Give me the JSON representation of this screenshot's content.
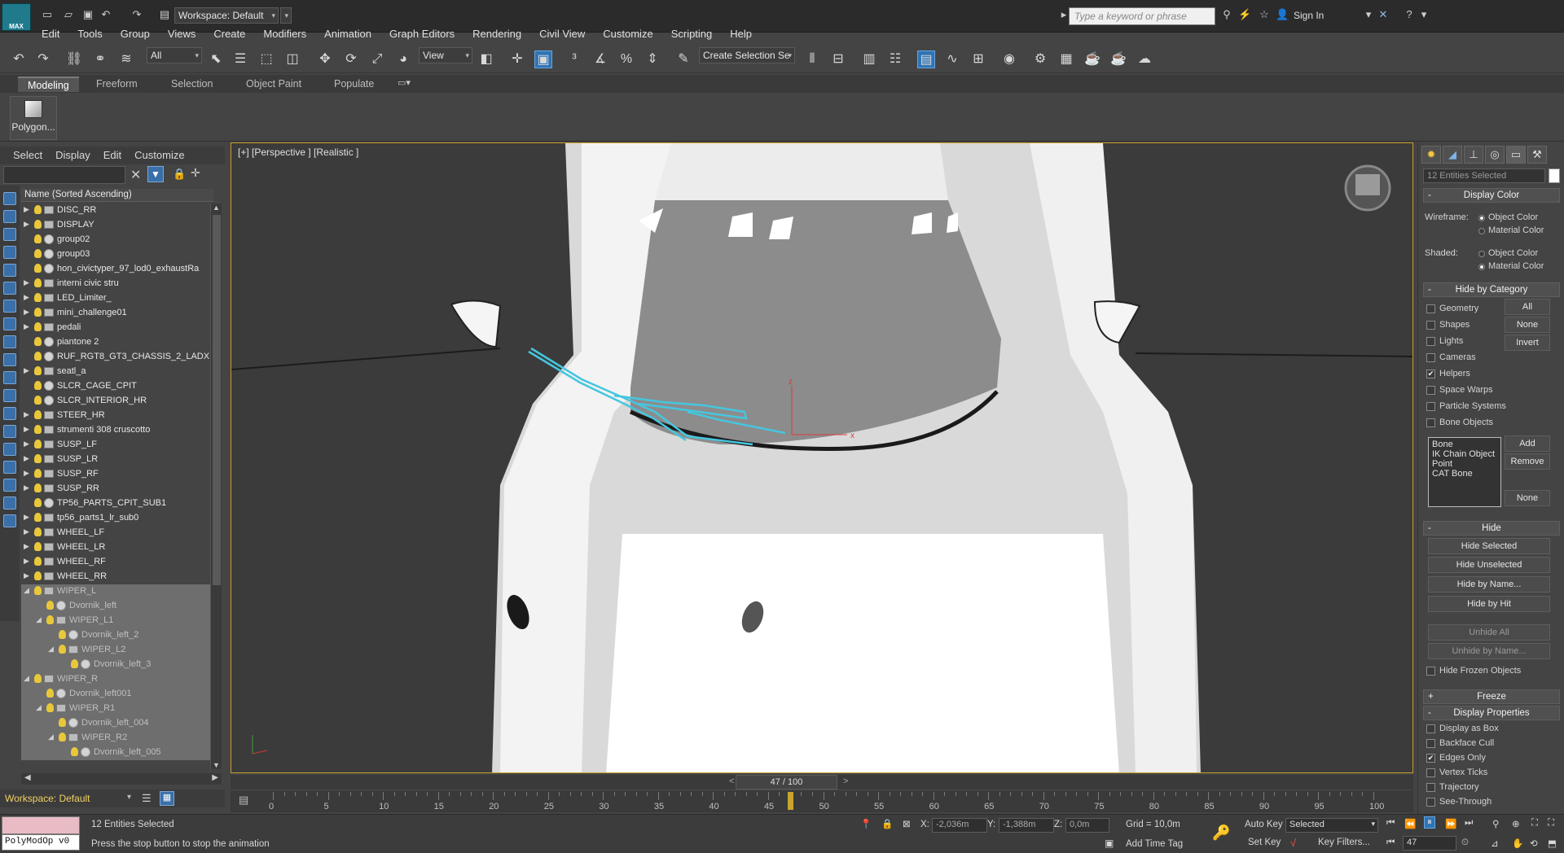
{
  "app": {
    "logo": "MAX",
    "workspace": "Workspace: Default"
  },
  "search": {
    "placeholder": "Type a keyword or phrase",
    "sign_in": "Sign In"
  },
  "menu": [
    "Edit",
    "Tools",
    "Group",
    "Views",
    "Create",
    "Modifiers",
    "Animation",
    "Graph Editors",
    "Rendering",
    "Civil View",
    "Customize",
    "Scripting",
    "Help"
  ],
  "toolbar": {
    "selection_filter": "All",
    "ref_coord": "View",
    "selection_set": "Create Selection Se"
  },
  "ribbon": {
    "tabs": [
      "Modeling",
      "Freeform",
      "Selection",
      "Object Paint",
      "Populate"
    ],
    "poly_button": "Polygon..."
  },
  "scene_explorer": {
    "menu": [
      "Select",
      "Display",
      "Edit",
      "Customize"
    ],
    "header": "Name (Sorted Ascending)",
    "rows": [
      {
        "label": "DISC_RR",
        "kind": "group",
        "depth": 0,
        "expand": "closed",
        "sel": false
      },
      {
        "label": "DISPLAY",
        "kind": "group",
        "depth": 0,
        "expand": "closed",
        "sel": false
      },
      {
        "label": "group02",
        "kind": "object",
        "depth": 0,
        "expand": "none",
        "sel": false
      },
      {
        "label": "group03",
        "kind": "object",
        "depth": 0,
        "expand": "none",
        "sel": false
      },
      {
        "label": "hon_civictyper_97_lod0_exhaustRa",
        "kind": "object",
        "depth": 0,
        "expand": "none",
        "sel": false
      },
      {
        "label": "interni civic stru",
        "kind": "group",
        "depth": 0,
        "expand": "closed",
        "sel": false
      },
      {
        "label": "LED_Limiter_",
        "kind": "group",
        "depth": 0,
        "expand": "closed",
        "sel": false
      },
      {
        "label": "mini_challenge01",
        "kind": "group",
        "depth": 0,
        "expand": "closed",
        "sel": false
      },
      {
        "label": "pedali",
        "kind": "group",
        "depth": 0,
        "expand": "closed",
        "sel": false
      },
      {
        "label": "piantone 2",
        "kind": "object",
        "depth": 0,
        "expand": "none",
        "sel": false
      },
      {
        "label": "RUF_RGT8_GT3_CHASSIS_2_LADX",
        "kind": "object",
        "depth": 0,
        "expand": "none",
        "sel": false
      },
      {
        "label": "seatl_a",
        "kind": "group",
        "depth": 0,
        "expand": "closed",
        "sel": false
      },
      {
        "label": "SLCR_CAGE_CPIT",
        "kind": "object",
        "depth": 0,
        "expand": "none",
        "sel": false
      },
      {
        "label": "SLCR_INTERIOR_HR",
        "kind": "object",
        "depth": 0,
        "expand": "none",
        "sel": false
      },
      {
        "label": "STEER_HR",
        "kind": "group",
        "depth": 0,
        "expand": "closed",
        "sel": false
      },
      {
        "label": "strumenti 308 cruscotto",
        "kind": "group",
        "depth": 0,
        "expand": "closed",
        "sel": false
      },
      {
        "label": "SUSP_LF",
        "kind": "group",
        "depth": 0,
        "expand": "closed",
        "sel": false
      },
      {
        "label": "SUSP_LR",
        "kind": "group",
        "depth": 0,
        "expand": "closed",
        "sel": false
      },
      {
        "label": "SUSP_RF",
        "kind": "group",
        "depth": 0,
        "expand": "closed",
        "sel": false
      },
      {
        "label": "SUSP_RR",
        "kind": "group",
        "depth": 0,
        "expand": "closed",
        "sel": false
      },
      {
        "label": "TP56_PARTS_CPIT_SUB1",
        "kind": "object",
        "depth": 0,
        "expand": "none",
        "sel": false
      },
      {
        "label": "tp56_parts1_lr_sub0",
        "kind": "group",
        "depth": 0,
        "expand": "closed",
        "sel": false
      },
      {
        "label": "WHEEL_LF",
        "kind": "group",
        "depth": 0,
        "expand": "closed",
        "sel": false
      },
      {
        "label": "WHEEL_LR",
        "kind": "group",
        "depth": 0,
        "expand": "closed",
        "sel": false
      },
      {
        "label": "WHEEL_RF",
        "kind": "group",
        "depth": 0,
        "expand": "closed",
        "sel": false
      },
      {
        "label": "WHEEL_RR",
        "kind": "group",
        "depth": 0,
        "expand": "closed",
        "sel": false
      },
      {
        "label": "WIPER_L",
        "kind": "group",
        "depth": 0,
        "expand": "open",
        "sel": true
      },
      {
        "label": "Dvornik_left",
        "kind": "object",
        "depth": 1,
        "expand": "none",
        "sel": true
      },
      {
        "label": "WIPER_L1",
        "kind": "group",
        "depth": 1,
        "expand": "open",
        "sel": true
      },
      {
        "label": "Dvornik_left_2",
        "kind": "object",
        "depth": 2,
        "expand": "none",
        "sel": true
      },
      {
        "label": "WIPER_L2",
        "kind": "group",
        "depth": 2,
        "expand": "open",
        "sel": true
      },
      {
        "label": "Dvornik_left_3",
        "kind": "object",
        "depth": 3,
        "expand": "none",
        "sel": true
      },
      {
        "label": "WIPER_R",
        "kind": "group",
        "depth": 0,
        "expand": "open",
        "sel": true
      },
      {
        "label": "Dvornik_left001",
        "kind": "object",
        "depth": 1,
        "expand": "none",
        "sel": true
      },
      {
        "label": "WIPER_R1",
        "kind": "group",
        "depth": 1,
        "expand": "open",
        "sel": true
      },
      {
        "label": "Dvornik_left_004",
        "kind": "object",
        "depth": 2,
        "expand": "none",
        "sel": true
      },
      {
        "label": "WIPER_R2",
        "kind": "group",
        "depth": 2,
        "expand": "open",
        "sel": true
      },
      {
        "label": "Dvornik_left_005",
        "kind": "object",
        "depth": 3,
        "expand": "none",
        "sel": true
      }
    ],
    "workspace_footer": "Workspace: Default"
  },
  "viewport": {
    "label": "[+] [Perspective ] [Realistic ]",
    "axis_x": "x",
    "axis_z": "z"
  },
  "timeline": {
    "frame_indicator": "47 / 100",
    "current_frame": 47,
    "tick_labels": [
      "0",
      "5",
      "10",
      "15",
      "20",
      "25",
      "30",
      "35",
      "40",
      "45",
      "50",
      "55",
      "60",
      "65",
      "70",
      "75",
      "80",
      "85",
      "90",
      "95",
      "100"
    ]
  },
  "status": {
    "script_listener": "PolyModOp v0",
    "selection_count": "12 Entities Selected",
    "prompt": "Press the stop button to stop the animation",
    "x_label": "X:",
    "x_value": "-2,036m",
    "y_label": "Y:",
    "y_value": "-1,388m",
    "z_label": "Z:",
    "z_value": "0,0m",
    "grid": "Grid = 10,0m",
    "add_time_tag": "Add Time Tag",
    "auto_key": "Auto Key",
    "auto_key_mode": "Selected",
    "set_key": "Set Key",
    "key_filters": "Key Filters...",
    "frame_field": "47"
  },
  "command_panel": {
    "selection_field": "12 Entities Selected",
    "display_color": {
      "title": "Display Color",
      "wireframe_label": "Wireframe:",
      "shaded_label": "Shaded:",
      "object_color": "Object Color",
      "material_color": "Material Color"
    },
    "hide_by_category": {
      "title": "Hide by Category",
      "items": [
        {
          "label": "Geometry",
          "checked": false
        },
        {
          "label": "Shapes",
          "checked": false
        },
        {
          "label": "Lights",
          "checked": false
        },
        {
          "label": "Cameras",
          "checked": false
        },
        {
          "label": "Helpers",
          "checked": true
        },
        {
          "label": "Space Warps",
          "checked": false
        },
        {
          "label": "Particle Systems",
          "checked": false
        },
        {
          "label": "Bone Objects",
          "checked": false
        }
      ],
      "all": "All",
      "none": "None",
      "invert": "Invert",
      "list": [
        "Bone",
        "IK Chain Object",
        "Point",
        "CAT Bone"
      ],
      "add": "Add",
      "remove": "Remove",
      "none2": "None"
    },
    "hide": {
      "title": "Hide",
      "buttons": [
        "Hide Selected",
        "Hide Unselected",
        "Hide by Name...",
        "Hide by Hit"
      ],
      "unhide_all": "Unhide All",
      "unhide_by_name": "Unhide by Name...",
      "hide_frozen": "Hide Frozen Objects"
    },
    "freeze": {
      "title": "Freeze"
    },
    "display_properties": {
      "title": "Display Properties",
      "items": [
        {
          "label": "Display as Box",
          "checked": false
        },
        {
          "label": "Backface Cull",
          "checked": false
        },
        {
          "label": "Edges Only",
          "checked": true
        },
        {
          "label": "Vertex Ticks",
          "checked": false
        },
        {
          "label": "Trajectory",
          "checked": false
        },
        {
          "label": "See-Through",
          "checked": false
        }
      ]
    }
  }
}
